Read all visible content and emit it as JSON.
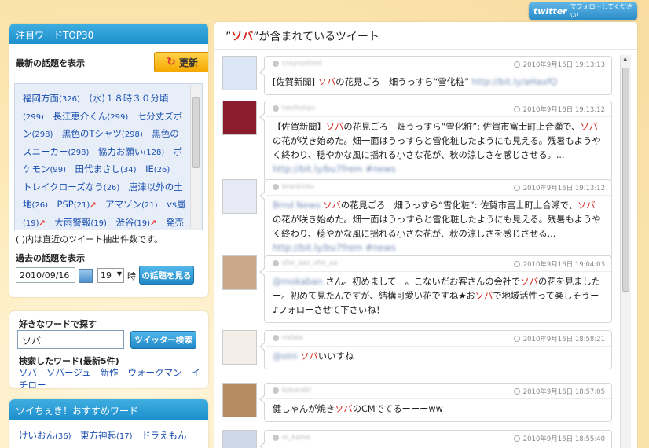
{
  "twitter_badge": {
    "logo": "twitter",
    "text": "でフォローしてください!"
  },
  "top30": {
    "title": "注目ワードTOP30",
    "latest_label": "最新の話題を表示",
    "update_label": "更新",
    "topics": [
      {
        "text": "福岡方面",
        "count": "(326)"
      },
      {
        "text": "(水)１８時３０分頃",
        "count": "(299)"
      },
      {
        "text": "長江恵介くん",
        "count": "(299)"
      },
      {
        "text": "七分丈ズボン",
        "count": "(298)"
      },
      {
        "text": "黒色のTシャツ",
        "count": "(298)"
      },
      {
        "text": "黒色のスニーカー",
        "count": "(298)"
      },
      {
        "text": "協力お願い",
        "count": "(128)"
      },
      {
        "text": "ポケモン",
        "count": "(99)"
      },
      {
        "text": "田代まさし",
        "count": "(34)"
      },
      {
        "text": "IE",
        "count": "(26)"
      },
      {
        "text": "トレイクローズなう",
        "count": "(26)"
      },
      {
        "text": "唐津以外の土地",
        "count": "(26)"
      },
      {
        "text": "PSP",
        "count": "(21)",
        "up": true
      },
      {
        "text": "アマゾン",
        "count": "(21)"
      },
      {
        "text": "vs嵐",
        "count": "(19)",
        "up": true
      },
      {
        "text": "大雨警報",
        "count": "(19)"
      },
      {
        "text": "渋谷",
        "count": "(19)",
        "up": true
      },
      {
        "text": "発売",
        "count": ""
      }
    ],
    "note": "( )内は直近のツイート抽出件数です。",
    "past_label": "過去の話題を表示",
    "date_value": "2010/09/16",
    "hour_value": "19",
    "hour_unit": "時",
    "view_button": "の話題を見る"
  },
  "search": {
    "label": "好きなワードで探す",
    "input_value": "ソバ",
    "button": "ツイッター検索",
    "recent_label": "検索したワード(最新5件)",
    "recent_words": [
      "ソバ",
      "ソバージュ",
      "新作",
      "ウォークマン",
      "イチロー"
    ]
  },
  "recommend": {
    "title": "ツイちぇき！おすすめワード",
    "items": [
      {
        "text": "けいおん",
        "count": "(36)"
      },
      {
        "text": "東方神起",
        "count": "(17)"
      },
      {
        "text": "ドラえもん",
        "count": ""
      }
    ]
  },
  "feed": {
    "title_prefix": "”",
    "keyword": "ソバ",
    "title_suffix": "”が含まれているツイート",
    "tweets": [
      {
        "user": "crayrustlaid",
        "time": "2010年9月16日 19:13:13",
        "parts": [
          {
            "t": "[佐賀新聞] "
          },
          {
            "t": "ソバ",
            "kw": true
          },
          {
            "t": "の花見ごろ　畑うっすら“雪化粧” "
          },
          {
            "t": "http://bit.ly/aHaxfQ",
            "blur": true
          }
        ]
      },
      {
        "user": "twofeelan",
        "time": "2010年9月16日 19:13:12",
        "parts": [
          {
            "t": "【佐賀新聞】"
          },
          {
            "t": "ソバ",
            "kw": true
          },
          {
            "t": "の花見ごろ　畑うっすら“雪化粧”: 佐賀市富士町上合瀬で、"
          },
          {
            "t": "ソバ",
            "kw": true
          },
          {
            "t": "の花が咲き始めた。畑一面はうっすらと雪化粧したようにも見える。残暑もようやく終わり、穏やかな風に揺れる小さな花が、秋の涼しさを感じさせる。... "
          },
          {
            "t": "http://bit.ly/bu7frem #news",
            "blur": true
          }
        ]
      },
      {
        "user": "brankintu",
        "time": "2010年9月16日 19:13:12",
        "parts": [
          {
            "t": "Brnd News ",
            "blur": true
          },
          {
            "t": "ソバ",
            "kw": true
          },
          {
            "t": "の花見ごろ　畑うっすら“雪化粧”: 佐賀市富士町上合瀬で、"
          },
          {
            "t": "ソバ",
            "kw": true
          },
          {
            "t": "の花が咲き始めた。畑一面はうっすらと雪化粧したようにも見える。残暑もようやく終わり、穏やかな風に揺れる小さな花が、秋の涼しさを感じさせる... "
          },
          {
            "t": "http://bit.ly/bu7frem #news",
            "blur": true
          }
        ]
      },
      {
        "user": "ohe_aao_ohe_aa",
        "time": "2010年9月16日 19:04:03",
        "parts": [
          {
            "t": "@mokaban ",
            "blur": true
          },
          {
            "t": "さん。初めましてー。こないだお客さんの会社で"
          },
          {
            "t": "ソバ",
            "kw": true
          },
          {
            "t": "の花を見ましたー。初めて見たんですが、結構可愛い花ですね★お"
          },
          {
            "t": "ソバ",
            "kw": true
          },
          {
            "t": "で地域活性って楽しそうー♪フォローさせて下さいね！"
          }
        ]
      },
      {
        "user": "rrelale",
        "time": "2010年9月16日 18:58:21",
        "parts": [
          {
            "t": "@oini ",
            "blur": true
          },
          {
            "t": "ソバ",
            "kw": true
          },
          {
            "t": "いいすね"
          }
        ]
      },
      {
        "user": "kobarabi",
        "time": "2010年9月16日 18:57:05",
        "parts": [
          {
            "t": "健しゃんが焼き"
          },
          {
            "t": "ソバ",
            "kw": true
          },
          {
            "t": "のCMでてるーーーww"
          }
        ]
      },
      {
        "user": "m_kame",
        "time": "2010年9月16日 18:55:40",
        "parts": [
          {
            "t": "..."
          }
        ]
      }
    ]
  }
}
